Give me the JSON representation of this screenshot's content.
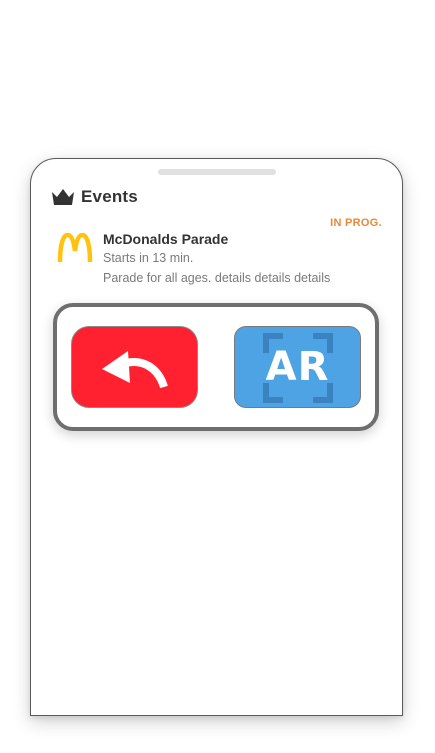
{
  "header": {
    "title": "Events",
    "icon": "crown-icon"
  },
  "event": {
    "status": "IN PROG.",
    "title": "McDonalds Parade",
    "time": "Starts in 13 min.",
    "description": "Parade for all ages. details details details",
    "logo_icon": "mcdonalds-logo"
  },
  "actions": {
    "back_icon": "undo-arrow-icon",
    "ar_label": "AR",
    "ar_icon": "ar-scan-frame-icon"
  },
  "colors": {
    "status": "#e8893a",
    "back_button": "#ff2030",
    "ar_button": "#4da3e4",
    "logo": "#ffc20e"
  }
}
